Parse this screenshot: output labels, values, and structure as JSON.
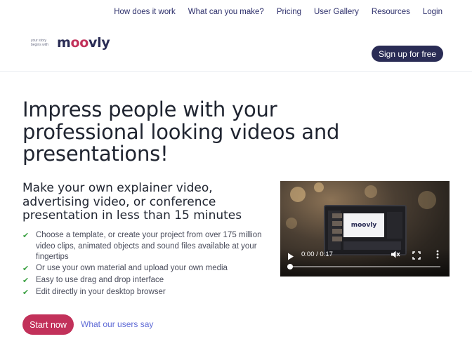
{
  "nav": {
    "items": [
      "How does it work",
      "What can you make?",
      "Pricing",
      "User Gallery",
      "Resources",
      "Login"
    ]
  },
  "logo": {
    "tagline": "your story begins with",
    "wordmark": "moovly"
  },
  "header": {
    "signup_label": "Sign up for free"
  },
  "hero": {
    "title": "Impress people with your professional looking videos and presentations!",
    "subtitle": "Make your own explainer video, advertising video, or conference presentation in less than 15 minutes",
    "features": [
      "Choose a template, or create your project from over 175 million video clips, animated objects and sound files available at your fingertips",
      "Or use your own material and upload your own media",
      "Easy to use drag and drop interface",
      "Edit directly in your desktop browser"
    ],
    "start_label": "Start now",
    "users_link": "What our users say"
  },
  "video": {
    "screen_logo": "moovly",
    "time_display": "0:00 / 0:17",
    "progress_fraction": 0.0,
    "icons": [
      "play-icon",
      "mute-icon",
      "fullscreen-icon",
      "more-icon"
    ]
  },
  "colors": {
    "brand_navy": "#2a2c55",
    "brand_pink": "#c2315a",
    "link_blue": "#5f6bd6",
    "check_green": "#3fa246"
  }
}
